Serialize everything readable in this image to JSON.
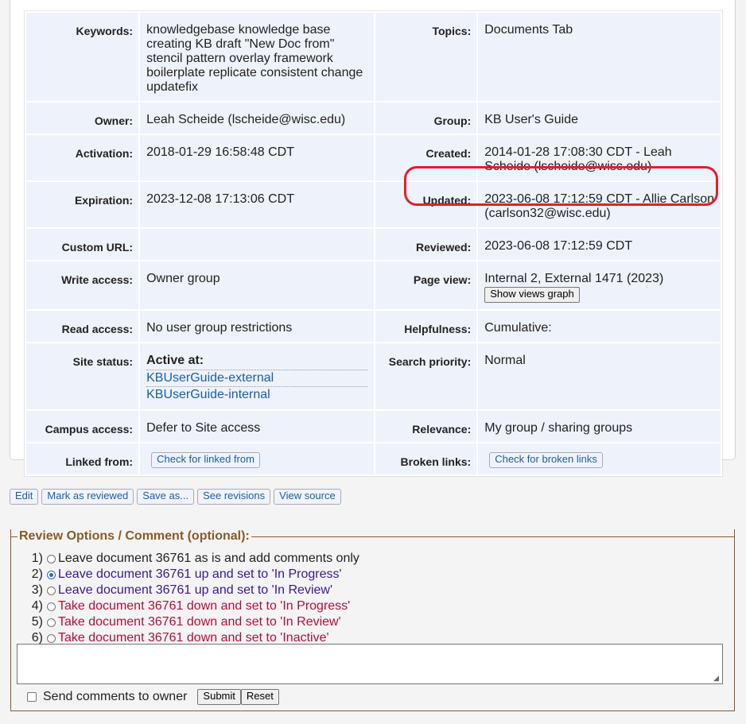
{
  "meta_rows": [
    {
      "l1": "Keywords:",
      "v1": "knowledgebase knowledge base creating KB draft \"New Doc from\" stencil pattern overlay framework boilerplate replicate consistent change updatefix",
      "l2": "Topics:",
      "v2": "Documents Tab"
    },
    {
      "l1": "Owner:",
      "v1": "Leah Scheide (lscheide@wisc.edu)",
      "l2": "Group:",
      "v2": "KB User's Guide"
    },
    {
      "l1": "Activation:",
      "v1": "2018-01-29 16:58:48 CDT",
      "l2": "Created:",
      "v2": "2014-01-28 17:08:30 CDT - Leah Scheide (lscheide@wisc.edu)"
    },
    {
      "l1": "Expiration:",
      "v1": "2023-12-08 17:13:06 CDT",
      "l2": "Updated:",
      "v2": "2023-06-08 17:12:59 CDT - Allie Carlson (carlson32@wisc.edu)"
    },
    {
      "l1": "Custom URL:",
      "v1": "",
      "l2": "Reviewed:",
      "v2": "2023-06-08 17:12:59 CDT"
    },
    {
      "l1": "Write access:",
      "v1": "Owner group",
      "l2": "Page view:",
      "v2": "Internal 2, External 1471 (2023)",
      "btn2": "Show views graph"
    },
    {
      "l1": "Read access:",
      "v1": "No user group restrictions",
      "l2": "Helpfulness:",
      "v2": "Cumulative:"
    },
    {
      "l1": "Site status:",
      "v1": "Active at:",
      "sites": [
        "KBUserGuide-external",
        "KBUserGuide-internal"
      ],
      "l2": "Search priority:",
      "v2": "Normal"
    },
    {
      "l1": "Campus access:",
      "v1": "Defer to Site access",
      "l2": "Relevance:",
      "v2": "My group / sharing groups"
    },
    {
      "l1": "Linked from:",
      "btn1": "Check for linked from",
      "l2": "Broken links:",
      "btn2": "Check for broken links"
    }
  ],
  "actions": [
    "Edit",
    "Mark as reviewed",
    "Save as...",
    "See revisions",
    "View source"
  ],
  "review": {
    "legend": "Review Options / Comment (optional):",
    "options": [
      {
        "num": "1)",
        "text": "Leave document 36761 as is and add comments only",
        "color": "#222222",
        "checked": false
      },
      {
        "num": "2)",
        "text": "Leave document 36761 up and set to 'In Progress'",
        "color": "#3b1a8c",
        "checked": true
      },
      {
        "num": "3)",
        "text": "Leave document 36761 up and set to 'In Review'",
        "color": "#3b1a8c",
        "checked": false
      },
      {
        "num": "4)",
        "text": "Take document 36761 down and set to 'In Progress'",
        "color": "#b0103a",
        "checked": false
      },
      {
        "num": "5)",
        "text": "Take document 36761 down and set to 'In Review'",
        "color": "#b0103a",
        "checked": false
      },
      {
        "num": "6)",
        "text": "Take document 36761 down and set to 'Inactive'",
        "color": "#b0103a",
        "checked": false
      }
    ],
    "send_label": "Send comments to owner",
    "submit_label": "Submit",
    "reset_label": "Reset"
  }
}
